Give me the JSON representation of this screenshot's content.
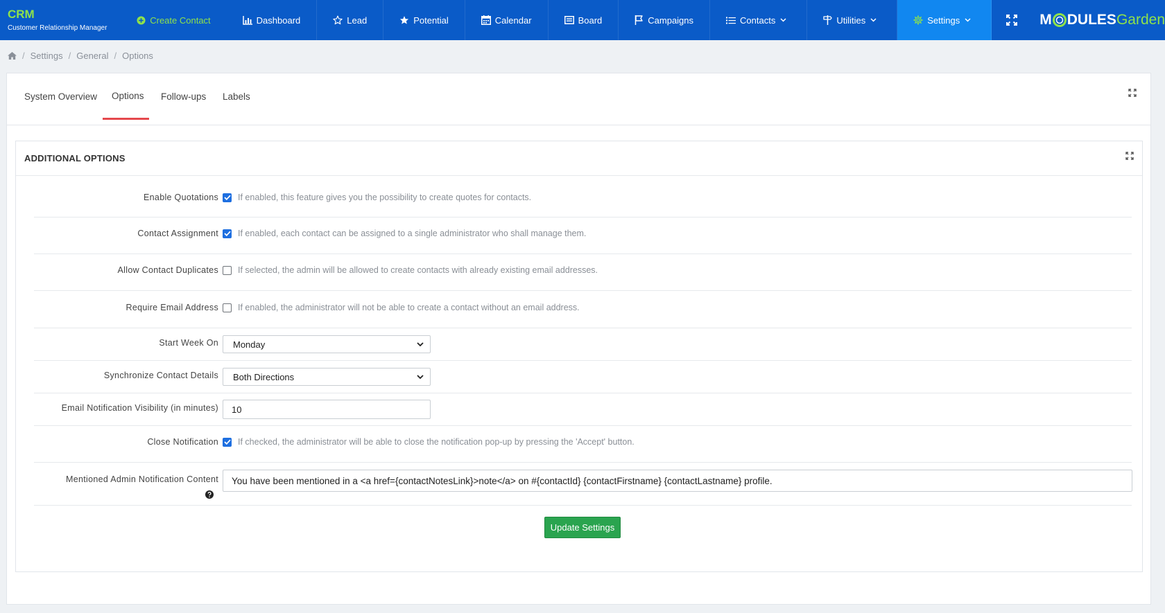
{
  "brand": {
    "title": "CRM",
    "subtitle": "Customer Relationship Manager"
  },
  "nav": {
    "create_contact": "Create Contact",
    "dashboard": "Dashboard",
    "lead": "Lead",
    "potential": "Potential",
    "calendar": "Calendar",
    "board": "Board",
    "campaigns": "Campaigns",
    "contacts": "Contacts",
    "utilities": "Utilities",
    "settings": "Settings"
  },
  "logo": {
    "part1": "M",
    "part2": "DULES",
    "part3": "Garden"
  },
  "breadcrumb": [
    "Settings",
    "General",
    "Options"
  ],
  "tabs": [
    "System Overview",
    "Options",
    "Follow-ups",
    "Labels"
  ],
  "panel": {
    "title": "ADDITIONAL OPTIONS"
  },
  "options": {
    "enable_quotations": {
      "label": "Enable Quotations",
      "checked": true,
      "hint": "If enabled, this feature gives you the possibility to create quotes for contacts."
    },
    "contact_assignment": {
      "label": "Contact Assignment",
      "checked": true,
      "hint": "If enabled, each contact can be assigned to a single administrator who shall manage them."
    },
    "allow_duplicates": {
      "label": "Allow Contact Duplicates",
      "checked": false,
      "hint": "If selected, the admin will be allowed to create contacts with already existing email addresses."
    },
    "require_email": {
      "label": "Require Email Address",
      "checked": false,
      "hint": "If enabled, the administrator will not be able to create a contact without an email address."
    },
    "start_week": {
      "label": "Start Week On",
      "value": "Monday"
    },
    "sync_details": {
      "label": "Synchronize Contact Details",
      "value": "Both Directions"
    },
    "email_visibility": {
      "label": "Email Notification Visibility (in minutes)",
      "value": "10"
    },
    "close_notification": {
      "label": "Close Notification",
      "checked": true,
      "hint": "If checked, the administrator will be able to close the notification pop-up by pressing the 'Accept' button."
    },
    "mentioned_content": {
      "label": "Mentioned Admin Notification Content",
      "value": "You have been mentioned in a <a href={contactNotesLink}>note</a> on #{contactId} {contactFirstname} {contactLastname} profile."
    }
  },
  "update_button": "Update Settings",
  "colors": {
    "topbar": "#0a5bc8",
    "accent_green": "#8fe24a",
    "active_tab": "#e5484d",
    "button": "#2aa44f",
    "checkbox": "#1e6fe0"
  }
}
